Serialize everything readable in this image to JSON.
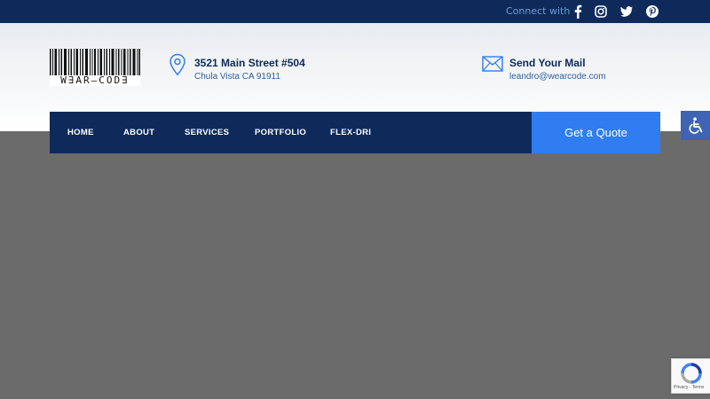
{
  "topbar": {
    "connect_label": "Connect with",
    "social_icons": [
      "facebook-icon",
      "instagram-icon",
      "twitter-icon",
      "pinterest-icon"
    ]
  },
  "header": {
    "logo_text": "W∃AR—COD∃",
    "address": {
      "title": "3521 Main Street #504",
      "subtitle": "Chula Vista CA 91911"
    },
    "mail": {
      "title": "Send Your Mail",
      "subtitle": "leandro@wearcode.com"
    }
  },
  "nav": {
    "items": [
      {
        "label": "HOME"
      },
      {
        "label": "ABOUT"
      },
      {
        "label": "SERVICES"
      },
      {
        "label": "PORTFOLIO"
      },
      {
        "label": "FLEX-DRI"
      }
    ],
    "cta_label": "Get a Quote"
  },
  "recaptcha": {
    "text": "Privacy - Terms"
  },
  "colors": {
    "navy": "#0d2a5a",
    "accent": "#2f7df0",
    "accessibility": "#3f63b5",
    "body_bg": "#6b6b6b"
  }
}
